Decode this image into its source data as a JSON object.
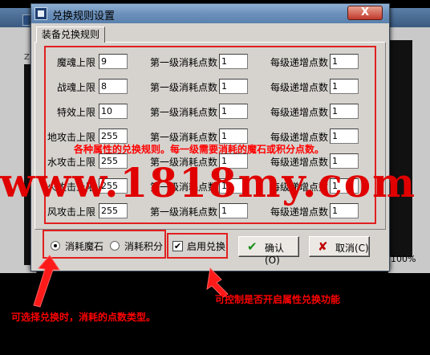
{
  "background_window": {
    "percent": "100%",
    "label": "Z"
  },
  "dialog": {
    "title": "兑换规则设置",
    "close_symbol": "X",
    "tab_label": "装备兑换规则"
  },
  "rows": [
    {
      "label": "魔魂上限",
      "limit": "9",
      "first_label": "第一级消耗点数",
      "first": "1",
      "inc_label": "每级递增点数",
      "inc": "1"
    },
    {
      "label": "战魂上限",
      "limit": "8",
      "first_label": "第一级消耗点数",
      "first": "1",
      "inc_label": "每级递增点数",
      "inc": "1"
    },
    {
      "label": "特效上限",
      "limit": "10",
      "first_label": "第一级消耗点数",
      "first": "1",
      "inc_label": "每级递增点数",
      "inc": "1"
    },
    {
      "label": "地攻击上限",
      "limit": "255",
      "first_label": "第一级消耗点数",
      "first": "1",
      "inc_label": "每级递增点数",
      "inc": "1"
    },
    {
      "label": "水攻击上限",
      "limit": "255",
      "first_label": "第一级消耗点数",
      "first": "1",
      "inc_label": "每级递增点数",
      "inc": "1"
    },
    {
      "label": "火攻击上限",
      "limit": "255",
      "first_label": "第一级消耗点数",
      "first": "1",
      "inc_label": "每级递增点数",
      "inc": "1"
    },
    {
      "label": "风攻击上限",
      "limit": "255",
      "first_label": "第一级消耗点数",
      "first": "1",
      "inc_label": "每级递增点数",
      "inc": "1"
    }
  ],
  "options": {
    "radio_stone": "消耗魔石",
    "radio_points": "消耗积分",
    "enable_label": "启用兑换",
    "enable_check": "✔",
    "ok_label": "确认 (O)",
    "cancel_label": "取消(C)",
    "ok_icon": "✔",
    "cancel_icon": "✘"
  },
  "annotations": {
    "rule_note": "各种属性的兑换规则。每一级需要消耗的魔石或积分点数。",
    "watermark": "www.1818my.com",
    "type_note": "可选择兑换时，消耗的点数类型。",
    "enable_note": "可控制是否开启属性兑换功能"
  },
  "colors": {
    "annotation_red": "#ff0000",
    "box_red": "#e02020",
    "ok_green": "#1a8f1a",
    "cancel_red": "#c00000"
  }
}
